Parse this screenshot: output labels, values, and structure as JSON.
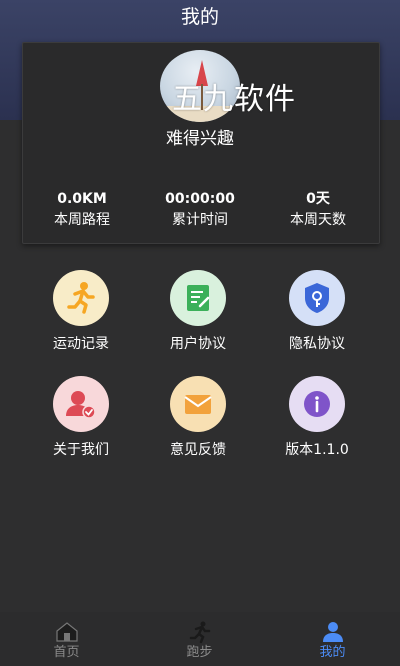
{
  "header": {
    "title": "我的"
  },
  "profile": {
    "watermark_text": "五九软件",
    "nickname": "难得兴趣",
    "stats": [
      {
        "value": "0.0KM",
        "label": "本周路程"
      },
      {
        "value": "00:00:00",
        "label": "累计时间"
      },
      {
        "value": "0天",
        "label": "本周天数"
      }
    ]
  },
  "menu": {
    "items": [
      {
        "label": "运动记录",
        "icon": "running-person-icon",
        "color": "#f6a623"
      },
      {
        "label": "用户协议",
        "icon": "document-edit-icon",
        "color": "#3cb05a"
      },
      {
        "label": "隐私协议",
        "icon": "shield-key-icon",
        "color": "#3b67d8"
      },
      {
        "label": "关于我们",
        "icon": "user-check-icon",
        "color": "#dd4a55"
      },
      {
        "label": "意见反馈",
        "icon": "mail-icon",
        "color": "#f2a23c"
      },
      {
        "label": "版本1.1.0",
        "icon": "info-icon",
        "color": "#7f54c9"
      }
    ]
  },
  "tabbar": {
    "tabs": [
      {
        "label": "首页",
        "icon": "home-icon"
      },
      {
        "label": "跑步",
        "icon": "runner-icon"
      },
      {
        "label": "我的",
        "icon": "person-icon",
        "active": true
      }
    ],
    "active_color": "#4c8cf5"
  }
}
